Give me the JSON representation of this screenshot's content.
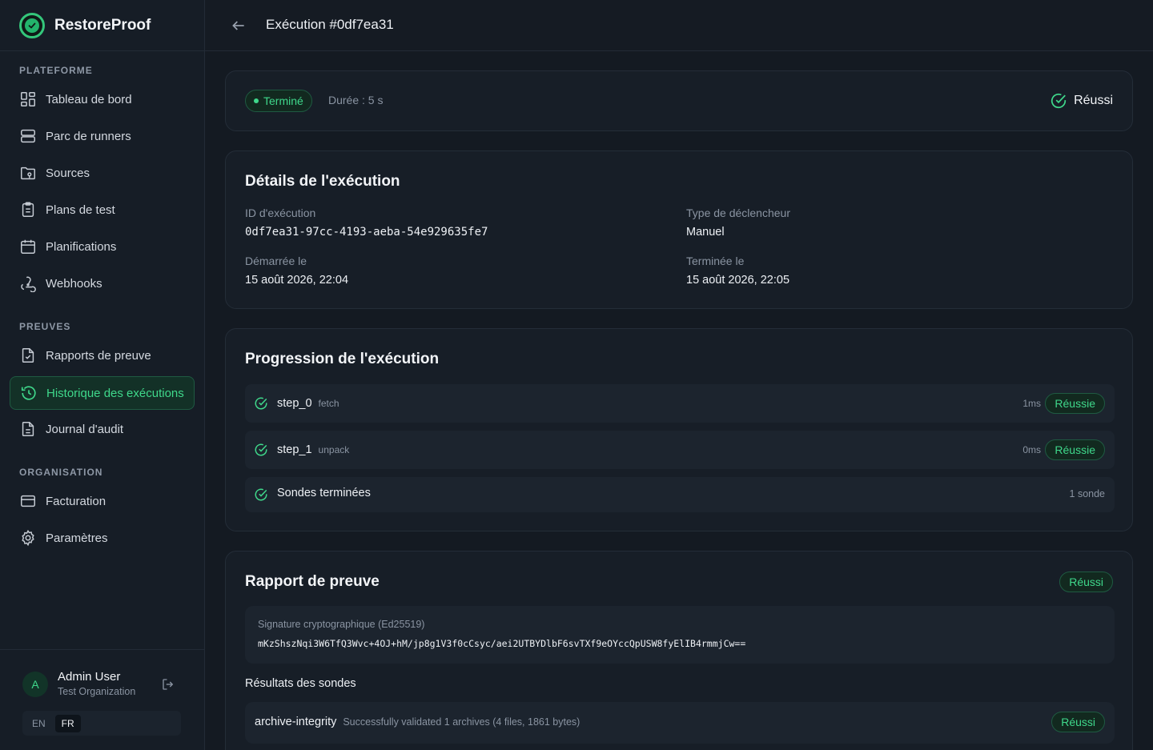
{
  "brand": {
    "name": "RestoreProof"
  },
  "nav": {
    "sections": [
      {
        "title": "PLATEFORME",
        "items": [
          "Tableau de bord",
          "Parc de runners",
          "Sources",
          "Plans de test",
          "Planifications",
          "Webhooks"
        ]
      },
      {
        "title": "PREUVES",
        "items": [
          "Rapports de preuve",
          "Historique des exécutions",
          "Journal d'audit"
        ]
      },
      {
        "title": "ORGANISATION",
        "items": [
          "Facturation",
          "Paramètres"
        ]
      }
    ],
    "active_item": "Historique des exécutions"
  },
  "user": {
    "initial": "A",
    "name": "Admin User",
    "org": "Test Organization"
  },
  "languages": {
    "options": [
      "EN",
      "FR"
    ],
    "selected": "FR"
  },
  "header": {
    "title": "Exécution #0df7ea31"
  },
  "summary": {
    "status": "Terminé",
    "duration": "Durée : 5 s",
    "result": "Réussi"
  },
  "details": {
    "title": "Détails de l'exécution",
    "run_id_label": "ID d'exécution",
    "run_id": "0df7ea31-97cc-4193-aeba-54e929635fe7",
    "trigger_label": "Type de déclencheur",
    "trigger": "Manuel",
    "started_label": "Démarrée le",
    "started": "15 août 2026, 22:04",
    "finished_label": "Terminée le",
    "finished": "15 août 2026, 22:05"
  },
  "progress": {
    "title": "Progression de l'exécution",
    "steps": [
      {
        "name": "step_0",
        "kind": "fetch",
        "time": "1ms",
        "status": "Réussie"
      },
      {
        "name": "step_1",
        "kind": "unpack",
        "time": "0ms",
        "status": "Réussie"
      }
    ],
    "probes_done": {
      "label": "Sondes terminées",
      "count": "1 sonde"
    }
  },
  "report": {
    "title": "Rapport de preuve",
    "status": "Réussi",
    "signature_label": "Signature cryptographique (Ed25519)",
    "signature": "mKzShszNqi3W6TfQ3Wvc+4OJ+hM/jp8g1V3f0cCsyc/aei2UTBYDlbF6svTXf9eOYccQpUSW8fyElIB4rmmjCw==",
    "probes_title": "Résultats des sondes",
    "probes": [
      {
        "name": "archive-integrity",
        "message": "Successfully validated 1 archives (4 files, 1861 bytes)",
        "status": "Réussi"
      }
    ]
  },
  "colors": {
    "accent": "#3fd88b",
    "background": "#141a22",
    "card": "#171e27"
  }
}
